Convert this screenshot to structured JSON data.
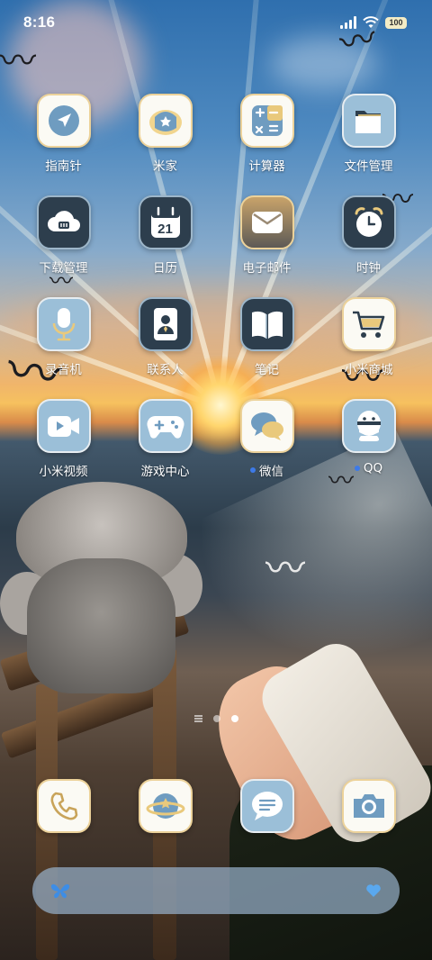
{
  "status_bar": {
    "time": "8:16",
    "battery": "100",
    "signal_icon": "cellular-signal-icon",
    "wifi_icon": "wifi-icon"
  },
  "apps": [
    {
      "label": "指南针",
      "icon": "compass-icon"
    },
    {
      "label": "米家",
      "icon": "mijia-home-icon"
    },
    {
      "label": "计算器",
      "icon": "calculator-icon"
    },
    {
      "label": "文件管理",
      "icon": "folder-icon"
    },
    {
      "label": "下载管理",
      "icon": "cloud-download-icon"
    },
    {
      "label": "日历",
      "icon": "calendar-icon",
      "date": "21"
    },
    {
      "label": "电子邮件",
      "icon": "mail-icon"
    },
    {
      "label": "时钟",
      "icon": "alarm-clock-icon"
    },
    {
      "label": "录音机",
      "icon": "microphone-icon"
    },
    {
      "label": "联系人",
      "icon": "contacts-icon"
    },
    {
      "label": "笔记",
      "icon": "notes-book-icon"
    },
    {
      "label": "小米商城",
      "icon": "shopping-cart-icon"
    },
    {
      "label": "小米视频",
      "icon": "video-camera-icon"
    },
    {
      "label": "游戏中心",
      "icon": "gamepad-icon"
    },
    {
      "label": "微信",
      "icon": "wechat-icon",
      "notification_dot": true
    },
    {
      "label": "QQ",
      "icon": "qq-penguin-icon",
      "notification_dot": true
    }
  ],
  "page_indicator": {
    "pages": 2,
    "active_page": 2
  },
  "dock": [
    {
      "icon": "phone-icon"
    },
    {
      "icon": "planet-browser-icon"
    },
    {
      "icon": "message-bubble-icon"
    },
    {
      "icon": "camera-icon"
    }
  ],
  "search_bar": {
    "left_icon": "butterfly-icon",
    "right_icon": "blue-heart-icon"
  },
  "colors": {
    "icon_dark_bg": "#2d3e4d",
    "icon_light_bg": "#fbfaf4",
    "icon_blue_bg": "#9bbfd8",
    "accent_blue": "#6f9cc0",
    "accent_gold": "#e9c97c",
    "notification_dot": "#3d7ae8"
  }
}
